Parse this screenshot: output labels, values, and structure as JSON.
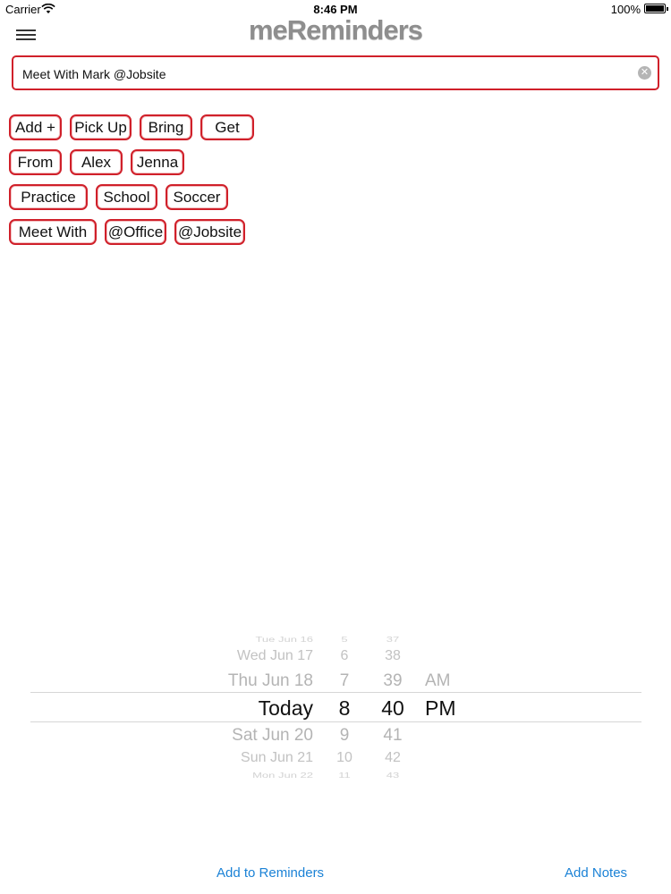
{
  "status_bar": {
    "carrier": "Carrier",
    "time": "8:46 PM",
    "battery": "100%"
  },
  "header": {
    "app_title": "meReminders"
  },
  "reminder": {
    "text": "Meet With Mark @Jobsite"
  },
  "tags": {
    "row1": [
      "Add +",
      "Pick Up",
      "Bring",
      "Get"
    ],
    "row2": [
      "From",
      "Alex",
      "Jenna"
    ],
    "row3": [
      "Practice",
      "School",
      "Soccer"
    ],
    "row4": [
      "Meet With",
      "@Office",
      "@Jobsite"
    ]
  },
  "picker": {
    "dates": [
      "Tue Jun 16",
      "Wed Jun 17",
      "Thu Jun 18",
      "Today",
      "Sat Jun 20",
      "Sun Jun 21",
      "Mon Jun 22"
    ],
    "hours": [
      "5",
      "6",
      "7",
      "8",
      "9",
      "10",
      "11"
    ],
    "minutes": [
      "37",
      "38",
      "39",
      "40",
      "41",
      "42",
      "43"
    ],
    "ampm": [
      "AM",
      "PM"
    ],
    "selected": {
      "date": "Today",
      "hour": "8",
      "minute": "40",
      "period": "PM"
    }
  },
  "footer": {
    "add_to_reminders": "Add to Reminders",
    "add_notes": "Add Notes"
  },
  "colors": {
    "chip_border": "#d0202a",
    "link": "#1b82d6",
    "logo": "#8e8e8e"
  }
}
